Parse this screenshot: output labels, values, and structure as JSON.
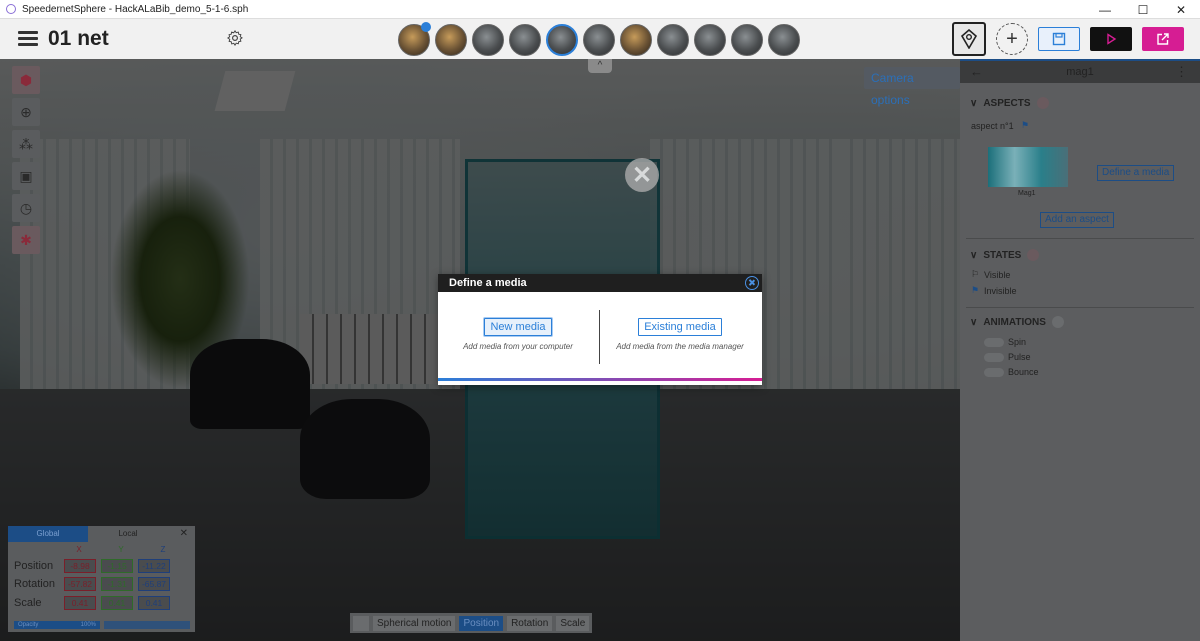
{
  "window": {
    "title": "SpeedernetSphere - HackALaBib_demo_5-1-6.sph",
    "minimize": "—",
    "maximize": "☐",
    "close": "✕"
  },
  "app": {
    "project_title": "01 net"
  },
  "viewport": {
    "camera_options": "Camera options",
    "collapse": "^"
  },
  "transform": {
    "tab_global": "Global",
    "tab_local": "Local",
    "close": "✕",
    "axes": [
      "X",
      "Y",
      "Z"
    ],
    "position_label": "Position",
    "rotation_label": "Rotation",
    "scale_label": "Scale",
    "position": [
      "-8.98",
      "-1.15",
      "-11.22"
    ],
    "rotation": [
      "-57.82",
      "-1.31",
      "-65.87"
    ],
    "scale": [
      "0.41",
      "0.41",
      "0.41"
    ],
    "opacity_label": "Opacity",
    "opacity_value": "100%"
  },
  "bottombar": {
    "spherical": "Spherical motion",
    "position": "Position",
    "rotation": "Rotation",
    "scale": "Scale"
  },
  "right_panel": {
    "title": "mag1",
    "aspects_label": "ASPECTS",
    "aspect_name": "aspect n°1",
    "media_caption": "Mag1",
    "define_media": "Define a media",
    "add_aspect": "Add an aspect",
    "states_label": "STATES",
    "state_visible": "Visible",
    "state_invisible": "Invisible",
    "animations_label": "ANIMATIONS",
    "anim_spin": "Spin",
    "anim_pulse": "Pulse",
    "anim_bounce": "Bounce"
  },
  "modal": {
    "title": "Define a media",
    "new_media": "New media",
    "new_media_desc": "Add media from your computer",
    "existing_media": "Existing media",
    "existing_media_desc": "Add media from the media manager"
  }
}
